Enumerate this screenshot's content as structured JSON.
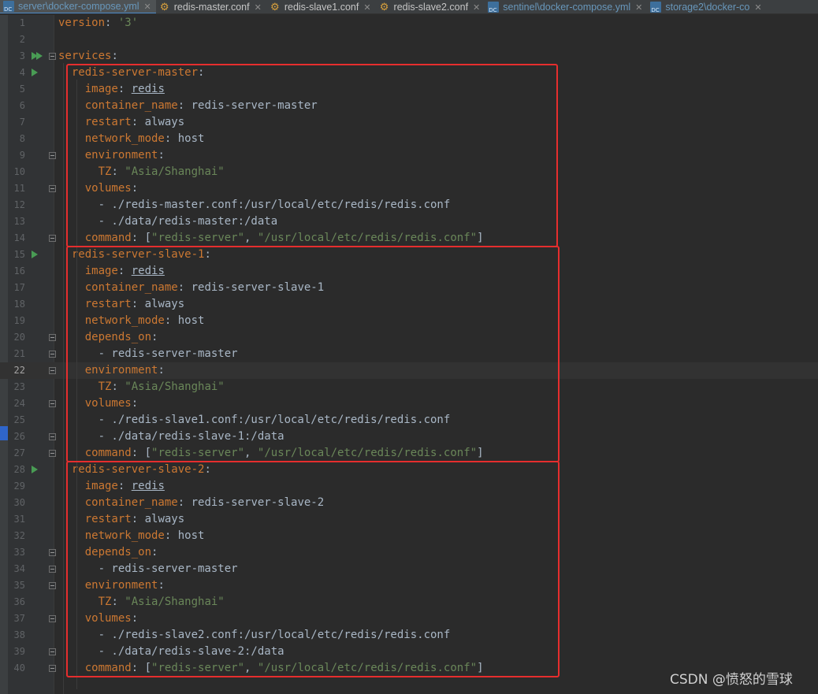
{
  "tabs": [
    {
      "label": "server\\docker-compose.yml",
      "icon": "docker-compose-file-icon",
      "kind": "yml",
      "active": true
    },
    {
      "label": "redis-master.conf",
      "icon": "gear-file-icon",
      "kind": "conf"
    },
    {
      "label": "redis-slave1.conf",
      "icon": "gear-file-icon",
      "kind": "conf"
    },
    {
      "label": "redis-slave2.conf",
      "icon": "gear-file-icon",
      "kind": "conf"
    },
    {
      "label": "sentinel\\docker-compose.yml",
      "icon": "docker-compose-file-icon",
      "kind": "yml"
    },
    {
      "label": "storage2\\docker-co",
      "icon": "docker-compose-file-icon",
      "kind": "yml"
    }
  ],
  "editor": {
    "current_line": 22,
    "lines": [
      [
        {
          "t": "version",
          "c": "k"
        },
        {
          "t": ": "
        },
        {
          "t": "'3'",
          "c": "s"
        }
      ],
      [],
      [
        {
          "t": "services",
          "c": "k"
        },
        {
          "t": ":"
        }
      ],
      [
        {
          "t": "  "
        },
        {
          "t": "redis-server-master",
          "c": "k"
        },
        {
          "t": ":"
        }
      ],
      [
        {
          "t": "    "
        },
        {
          "t": "image",
          "c": "k"
        },
        {
          "t": ": "
        },
        {
          "t": "redis",
          "c": "u"
        }
      ],
      [
        {
          "t": "    "
        },
        {
          "t": "container_name",
          "c": "k"
        },
        {
          "t": ": redis-server-master"
        }
      ],
      [
        {
          "t": "    "
        },
        {
          "t": "restart",
          "c": "k"
        },
        {
          "t": ": always"
        }
      ],
      [
        {
          "t": "    "
        },
        {
          "t": "network_mode",
          "c": "k"
        },
        {
          "t": ": host"
        }
      ],
      [
        {
          "t": "    "
        },
        {
          "t": "environment",
          "c": "k"
        },
        {
          "t": ":"
        }
      ],
      [
        {
          "t": "      "
        },
        {
          "t": "TZ",
          "c": "k"
        },
        {
          "t": ": "
        },
        {
          "t": "\"Asia/Shanghai\"",
          "c": "s"
        }
      ],
      [
        {
          "t": "    "
        },
        {
          "t": "volumes",
          "c": "k"
        },
        {
          "t": ":"
        }
      ],
      [
        {
          "t": "      - ./redis-master.conf:/usr/local/etc/redis/redis.conf"
        }
      ],
      [
        {
          "t": "      - ./data/redis-master:/data"
        }
      ],
      [
        {
          "t": "    "
        },
        {
          "t": "command",
          "c": "k"
        },
        {
          "t": ": ["
        },
        {
          "t": "\"redis-server\"",
          "c": "s"
        },
        {
          "t": ", "
        },
        {
          "t": "\"/usr/local/etc/redis/redis.conf\"",
          "c": "s"
        },
        {
          "t": "]"
        }
      ],
      [
        {
          "t": "  "
        },
        {
          "t": "redis-server-slave-1",
          "c": "k"
        },
        {
          "t": ":"
        }
      ],
      [
        {
          "t": "    "
        },
        {
          "t": "image",
          "c": "k"
        },
        {
          "t": ": "
        },
        {
          "t": "redis",
          "c": "u"
        }
      ],
      [
        {
          "t": "    "
        },
        {
          "t": "container_name",
          "c": "k"
        },
        {
          "t": ": redis-server-slave-1"
        }
      ],
      [
        {
          "t": "    "
        },
        {
          "t": "restart",
          "c": "k"
        },
        {
          "t": ": always"
        }
      ],
      [
        {
          "t": "    "
        },
        {
          "t": "network_mode",
          "c": "k"
        },
        {
          "t": ": host"
        }
      ],
      [
        {
          "t": "    "
        },
        {
          "t": "depends_on",
          "c": "k"
        },
        {
          "t": ":"
        }
      ],
      [
        {
          "t": "      - redis-server-master"
        }
      ],
      [
        {
          "t": "    "
        },
        {
          "t": "environment",
          "c": "k"
        },
        {
          "t": ":"
        }
      ],
      [
        {
          "t": "      "
        },
        {
          "t": "TZ",
          "c": "k"
        },
        {
          "t": ": "
        },
        {
          "t": "\"Asia/Shanghai\"",
          "c": "s"
        }
      ],
      [
        {
          "t": "    "
        },
        {
          "t": "volumes",
          "c": "k"
        },
        {
          "t": ":"
        }
      ],
      [
        {
          "t": "      - ./redis-slave1.conf:/usr/local/etc/redis/redis.conf"
        }
      ],
      [
        {
          "t": "      - ./data/redis-slave-1:/data"
        }
      ],
      [
        {
          "t": "    "
        },
        {
          "t": "command",
          "c": "k"
        },
        {
          "t": ": ["
        },
        {
          "t": "\"redis-server\"",
          "c": "s"
        },
        {
          "t": ", "
        },
        {
          "t": "\"/usr/local/etc/redis/redis.conf\"",
          "c": "s"
        },
        {
          "t": "]"
        }
      ],
      [
        {
          "t": "  "
        },
        {
          "t": "redis-server-slave-2",
          "c": "k"
        },
        {
          "t": ":"
        }
      ],
      [
        {
          "t": "    "
        },
        {
          "t": "image",
          "c": "k"
        },
        {
          "t": ": "
        },
        {
          "t": "redis",
          "c": "u"
        }
      ],
      [
        {
          "t": "    "
        },
        {
          "t": "container_name",
          "c": "k"
        },
        {
          "t": ": redis-server-slave-2"
        }
      ],
      [
        {
          "t": "    "
        },
        {
          "t": "restart",
          "c": "k"
        },
        {
          "t": ": always"
        }
      ],
      [
        {
          "t": "    "
        },
        {
          "t": "network_mode",
          "c": "k"
        },
        {
          "t": ": host"
        }
      ],
      [
        {
          "t": "    "
        },
        {
          "t": "depends_on",
          "c": "k"
        },
        {
          "t": ":"
        }
      ],
      [
        {
          "t": "      - redis-server-master"
        }
      ],
      [
        {
          "t": "    "
        },
        {
          "t": "environment",
          "c": "k"
        },
        {
          "t": ":"
        }
      ],
      [
        {
          "t": "      "
        },
        {
          "t": "TZ",
          "c": "k"
        },
        {
          "t": ": "
        },
        {
          "t": "\"Asia/Shanghai\"",
          "c": "s"
        }
      ],
      [
        {
          "t": "    "
        },
        {
          "t": "volumes",
          "c": "k"
        },
        {
          "t": ":"
        }
      ],
      [
        {
          "t": "      - ./redis-slave2.conf:/usr/local/etc/redis/redis.conf"
        }
      ],
      [
        {
          "t": "      - ./data/redis-slave-2:/data"
        }
      ],
      [
        {
          "t": "    "
        },
        {
          "t": "command",
          "c": "k"
        },
        {
          "t": ": ["
        },
        {
          "t": "\"redis-server\"",
          "c": "s"
        },
        {
          "t": ", "
        },
        {
          "t": "\"/usr/local/etc/redis/redis.conf\"",
          "c": "s"
        },
        {
          "t": "]"
        }
      ]
    ],
    "run_gutter_lines": [
      3,
      4,
      15,
      28
    ],
    "fold_marker_lines": [
      3,
      9,
      11,
      14,
      20,
      21,
      22,
      24,
      26,
      27,
      33,
      34,
      35,
      37,
      39,
      40
    ],
    "highlight_boxes": [
      {
        "label": "redis-server-master",
        "from_line": 4,
        "to_line": 14
      },
      {
        "label": "redis-server-slave-1",
        "from_line": 15,
        "to_line": 27
      },
      {
        "label": "redis-server-slave-2",
        "from_line": 28,
        "to_line": 40
      }
    ]
  },
  "watermark": "CSDN @愤怒的雪球",
  "colors": {
    "background": "#2b2b2b",
    "keyword": "#cc7832",
    "string": "#6a8759",
    "text": "#a9b7c6",
    "line_number": "#606366",
    "run_icon": "#499c54",
    "highlight_box": "#e62e2e"
  }
}
